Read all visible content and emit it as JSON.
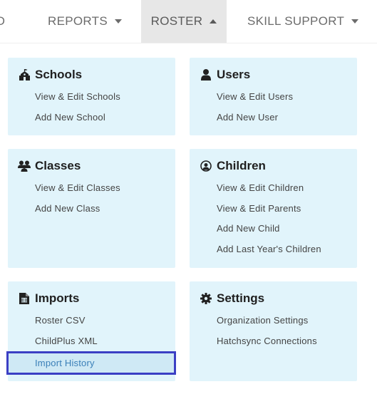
{
  "nav": {
    "items": [
      {
        "label": "DASHBOARD",
        "visible_text": "RD"
      },
      {
        "label": "REPORTS"
      },
      {
        "label": "ROSTER"
      },
      {
        "label": "SKILL SUPPORT"
      }
    ]
  },
  "menu": {
    "schools": {
      "title": "Schools",
      "links": [
        "View & Edit Schools",
        "Add New School"
      ]
    },
    "users": {
      "title": "Users",
      "links": [
        "View & Edit Users",
        "Add New User"
      ]
    },
    "classes": {
      "title": "Classes",
      "links": [
        "View & Edit Classes",
        "Add New Class"
      ]
    },
    "children": {
      "title": "Children",
      "links": [
        "View & Edit Children",
        "View & Edit Parents",
        "Add New Child",
        "Add Last Year's Children"
      ]
    },
    "imports": {
      "title": "Imports",
      "links": [
        "Roster CSV",
        "ChildPlus XML",
        "Import History"
      ]
    },
    "settings": {
      "title": "Settings",
      "links": [
        "Organization Settings",
        "Hatchsync Connections"
      ]
    }
  },
  "icons": {
    "schools": "school-icon",
    "users": "user-icon",
    "classes": "people-icon",
    "children": "child-icon",
    "imports": "file-icon",
    "settings": "gear-icon"
  },
  "colors": {
    "card_bg": "#e1f4fb",
    "selected_border": "#3b3fc4",
    "selected_text": "#3a7fb8",
    "active_tab_bg": "#e7e7e7"
  }
}
